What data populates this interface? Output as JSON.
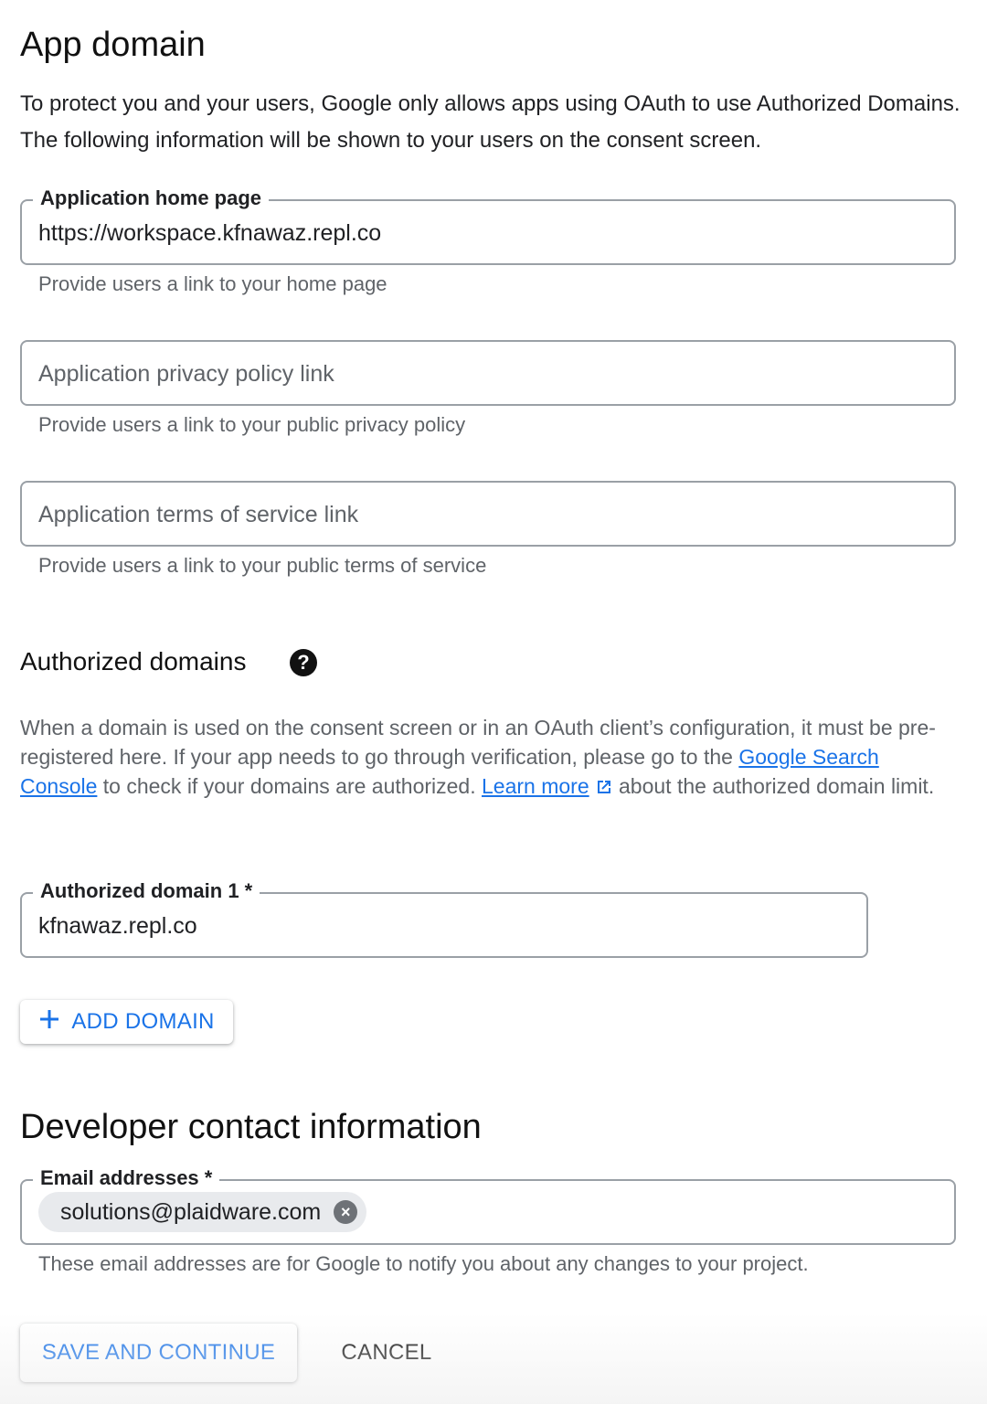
{
  "app_domain": {
    "title": "App domain",
    "intro": "To protect you and your users, Google only allows apps using OAuth to use Authorized Domains. The following information will be shown to your users on the consent screen.",
    "home_page": {
      "label": "Application home page",
      "value": "https://workspace.kfnawaz.repl.co",
      "hint": "Provide users a link to your home page"
    },
    "privacy_policy": {
      "placeholder": "Application privacy policy link",
      "hint": "Provide users a link to your public privacy policy"
    },
    "terms_of_service": {
      "placeholder": "Application terms of service link",
      "hint": "Provide users a link to your public terms of service"
    }
  },
  "authorized_domains": {
    "title": "Authorized domains",
    "help_icon": "?",
    "desc_part1": "When a domain is used on the consent screen or in an OAuth client’s configuration, it must be pre-registered here. If your app needs to go through verification, please go to the ",
    "link_search_console": "Google Search Console",
    "desc_part2": " to check if your domains are authorized. ",
    "link_learn_more": "Learn more",
    "desc_part3": " about the authorized domain limit.",
    "domain1": {
      "label": "Authorized domain 1 *",
      "value": "kfnawaz.repl.co"
    },
    "add_domain_label": "ADD DOMAIN",
    "add_icon": "+"
  },
  "developer_contact": {
    "title": "Developer contact information",
    "email_label": "Email addresses *",
    "email_chip": "solutions@plaidware.com",
    "chip_remove_icon": "×",
    "hint": "These email addresses are for Google to notify you about any changes to your project."
  },
  "actions": {
    "save_label": "SAVE AND CONTINUE",
    "cancel_label": "CANCEL"
  },
  "colors": {
    "accent": "#1a73e8",
    "border": "#9aa0a6",
    "hint_text": "#5f6368"
  }
}
